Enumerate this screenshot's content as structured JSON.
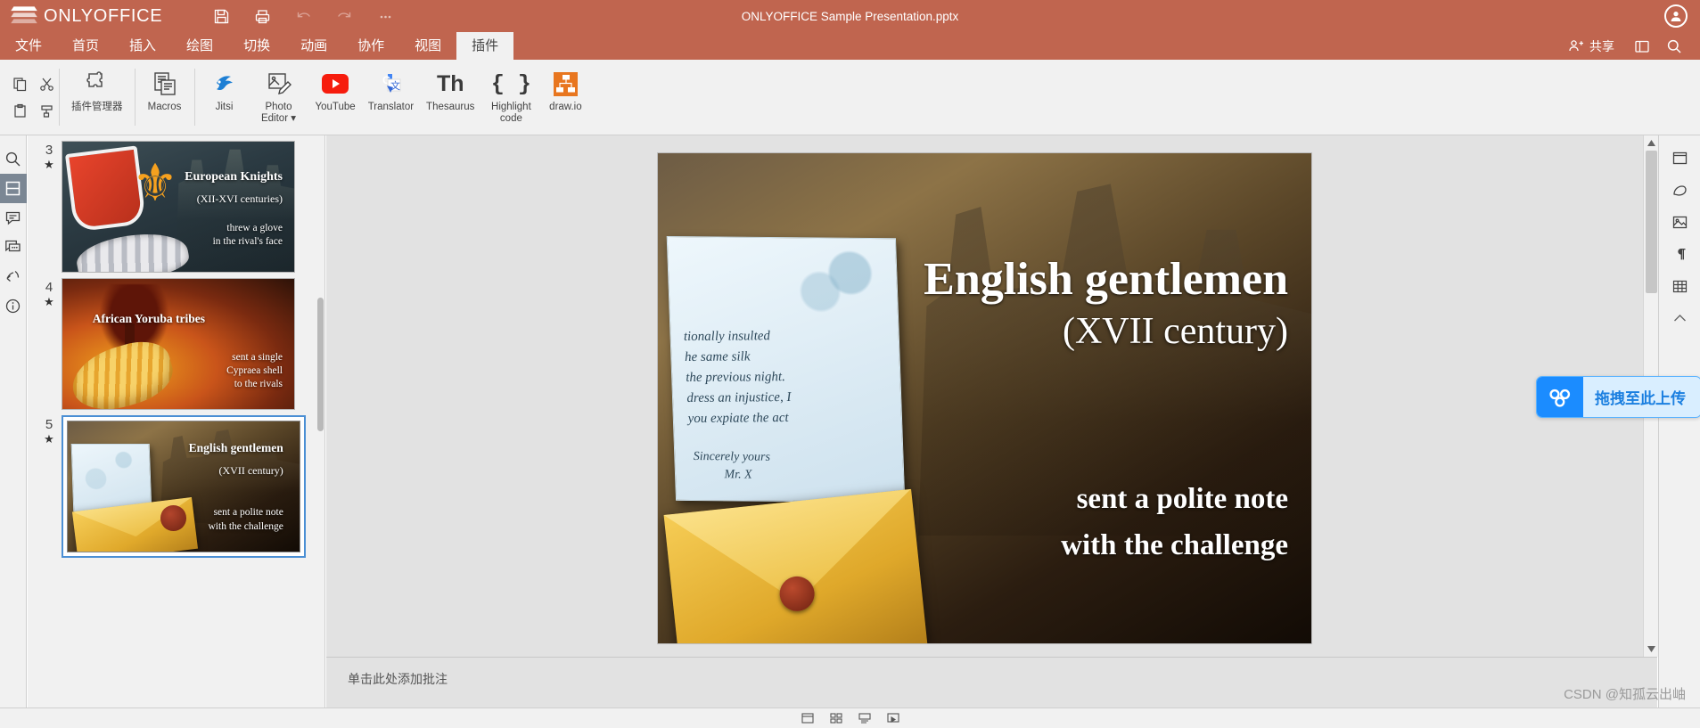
{
  "app": {
    "brand": "ONLYOFFICE",
    "document_title": "ONLYOFFICE Sample Presentation.pptx"
  },
  "titlebar": {
    "icons": [
      {
        "name": "save-icon",
        "label": "保存"
      },
      {
        "name": "print-icon",
        "label": "打印"
      },
      {
        "name": "undo-icon",
        "label": "撤销"
      },
      {
        "name": "redo-icon",
        "label": "重做"
      },
      {
        "name": "more-icon",
        "label": "更多"
      }
    ]
  },
  "menubar": {
    "tabs": [
      {
        "label": "文件",
        "active": false
      },
      {
        "label": "首页",
        "active": false
      },
      {
        "label": "插入",
        "active": false
      },
      {
        "label": "绘图",
        "active": false
      },
      {
        "label": "切换",
        "active": false
      },
      {
        "label": "动画",
        "active": false
      },
      {
        "label": "协作",
        "active": false
      },
      {
        "label": "视图",
        "active": false
      },
      {
        "label": "插件",
        "active": true
      }
    ],
    "share_label": "共享",
    "right_icons": [
      {
        "name": "open-location-icon"
      },
      {
        "name": "search-icon"
      }
    ]
  },
  "ribbon": {
    "clipboard": [
      {
        "name": "copy-icon"
      },
      {
        "name": "cut-icon"
      },
      {
        "name": "paste-icon"
      },
      {
        "name": "format-painter-icon"
      }
    ],
    "plugins": [
      {
        "label": "插件管理器",
        "icon": "puzzle-icon"
      },
      {
        "label": "Macros",
        "icon": "macros-icon"
      },
      {
        "label": "Jitsi",
        "icon": "jitsi-icon"
      },
      {
        "label": "Photo Editor",
        "icon": "photo-editor-icon",
        "caret": true
      },
      {
        "label": "YouTube",
        "icon": "youtube-icon"
      },
      {
        "label": "Translator",
        "icon": "translator-icon"
      },
      {
        "label": "Thesaurus",
        "icon": "thesaurus-icon"
      },
      {
        "label": "Highlight code",
        "icon": "highlight-code-icon"
      },
      {
        "label": "draw.io",
        "icon": "drawio-icon"
      }
    ]
  },
  "left_rail": {
    "items": [
      {
        "name": "search-icon",
        "active": false
      },
      {
        "name": "slides-icon",
        "active": true
      },
      {
        "name": "comments-icon",
        "active": false
      },
      {
        "name": "chat-icon",
        "active": false
      },
      {
        "name": "feedback-icon",
        "active": false
      },
      {
        "name": "about-icon",
        "active": false
      }
    ]
  },
  "right_rail": {
    "items": [
      {
        "name": "slide-settings-icon"
      },
      {
        "name": "shape-settings-icon"
      },
      {
        "name": "image-settings-icon"
      },
      {
        "name": "paragraph-settings-icon"
      },
      {
        "name": "table-settings-icon"
      },
      {
        "name": "collapse-icon"
      }
    ]
  },
  "thumbnails": [
    {
      "number": "3",
      "star": "★",
      "selected": false,
      "art": "knight",
      "title": "European Knights",
      "subtitle": "(XII-XVI centuries)",
      "body_line1": "threw a glove",
      "body_line2": "in the rival's face"
    },
    {
      "number": "4",
      "star": "★",
      "selected": false,
      "art": "yoruba",
      "title": "African Yoruba tribes",
      "subtitle": "",
      "body_line1": "sent a single",
      "body_line2": "Cypraea shell",
      "body_line3": "to the rivals"
    },
    {
      "number": "5",
      "star": "★",
      "selected": true,
      "art": "english",
      "title": "English gentlemen",
      "subtitle": "(XVII century)",
      "body_line1": "sent a polite note",
      "body_line2": "with the challenge"
    }
  ],
  "slide": {
    "title": "English gentlemen",
    "subtitle": "(XVII century)",
    "body_line1": "sent a polite note",
    "body_line2": "with the challenge",
    "letter_lines": [
      "tionally insulted",
      "he same silk",
      "the previous night.",
      "dress an injustice, I",
      "you expiate the act"
    ],
    "signature_line1": "Sincerely yours",
    "signature_line2": "Mr. X"
  },
  "notes": {
    "placeholder": "单击此处添加批注"
  },
  "statusbar": {
    "icons": [
      {
        "name": "normal-view-icon"
      },
      {
        "name": "slide-sorter-icon"
      },
      {
        "name": "notes-view-icon"
      },
      {
        "name": "presenter-view-icon"
      }
    ]
  },
  "upload_widget": {
    "label": "拖拽至此上传",
    "icon": "baidu-netdisk-icon",
    "accent": "#1b8cff"
  },
  "watermark": {
    "text": "CSDN @知孤云出岫"
  },
  "colors": {
    "brand_header": "#c0654f",
    "ribbon_bg": "#f1f1f1",
    "canvas_bg": "#e2e2e2",
    "selection_blue": "#4b8fd4"
  }
}
